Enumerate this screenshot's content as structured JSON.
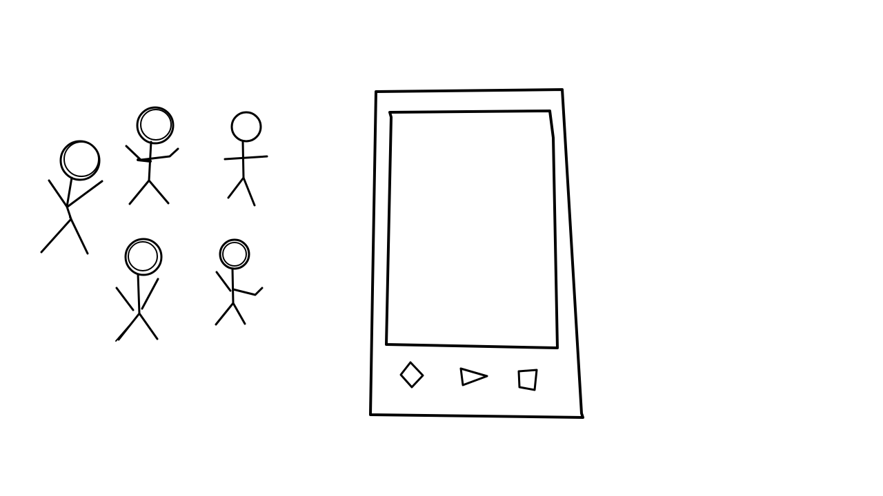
{
  "scene": {
    "background": "#ffffff",
    "ink_color": "#000000",
    "people_count": 5,
    "phone_buttons": [
      "diamond-icon",
      "play-icon",
      "square-icon"
    ]
  }
}
